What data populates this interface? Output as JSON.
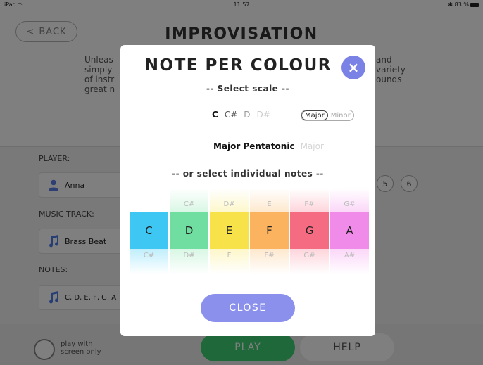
{
  "status_bar": {
    "device": "iPad",
    "time": "11:57",
    "battery": "83 %"
  },
  "header": {
    "back_label": "BACK",
    "title": "IMPROVISATION"
  },
  "intro": {
    "left_lines": [
      "Unleas",
      "simply",
      "of instr",
      "great n"
    ],
    "right_lines": [
      "and",
      "variety",
      "ounds"
    ]
  },
  "settings": {
    "player_label": "PLAYER:",
    "player_value": "Anna",
    "track_label": "MUSIC TRACK:",
    "track_value": "Brass Beat",
    "notes_label": "NOTES:",
    "notes_value": "C, D, E, F, G, A",
    "numbers": [
      "5",
      "6"
    ]
  },
  "bottom": {
    "screen_only_label": "play with screen only",
    "play_label": "PLAY",
    "help_label": "HELP"
  },
  "modal": {
    "title": "NOTE PER COLOUR",
    "close_x": "×",
    "select_scale_label": "-- Select scale --",
    "keys": [
      "C",
      "C#",
      "D",
      "D#"
    ],
    "mode_major": "Major",
    "mode_minor": "Minor",
    "scale_selected": "Major Pentatonic",
    "scale_next": "Major",
    "individual_label": "-- or select individual notes --",
    "close_label": "CLOSE",
    "notes": [
      {
        "top": "",
        "main": "C",
        "bottom": "C#",
        "color": "#3ec7f2",
        "top_color": "#ffffff",
        "bottom_color": "#bfeefc"
      },
      {
        "top": "C#",
        "main": "D",
        "bottom": "D#",
        "color": "#6fdea0",
        "top_color": "#d8f7e4",
        "bottom_color": "#d8f7e4"
      },
      {
        "top": "D#",
        "main": "E",
        "bottom": "F",
        "color": "#f7e24a",
        "top_color": "#fdf7c9",
        "bottom_color": "#fdf7c9"
      },
      {
        "top": "E",
        "main": "F",
        "bottom": "F#",
        "color": "#fbb360",
        "top_color": "#fee8cd",
        "bottom_color": "#fee8cd"
      },
      {
        "top": "F#",
        "main": "G",
        "bottom": "G#",
        "color": "#f56b82",
        "top_color": "#fdd4db",
        "bottom_color": "#fdd4db"
      },
      {
        "top": "G#",
        "main": "A",
        "bottom": "A#",
        "color": "#f18bea",
        "top_color": "#fbd6f8",
        "bottom_color": "#fbd6f8"
      }
    ]
  }
}
